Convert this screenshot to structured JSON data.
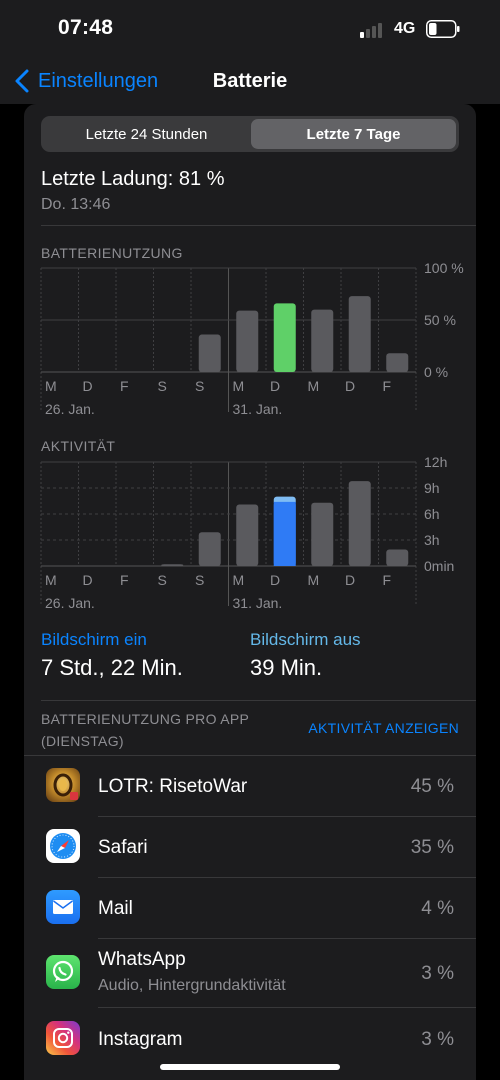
{
  "status": {
    "time": "07:48",
    "network": "4G",
    "battery_fraction": 0.3
  },
  "nav": {
    "back_label": "Einstellungen",
    "title": "Batterie"
  },
  "segments": [
    {
      "label": "Letzte 24 Stunden",
      "active": false
    },
    {
      "label": "Letzte 7 Tage",
      "active": true
    }
  ],
  "last_charge": {
    "label": "Letzte Ladung: 81 %",
    "time": "Do. 13:46"
  },
  "usage_title": "BATTERIENUTZUNG",
  "activity_title": "AKTIVITÄT",
  "screen": {
    "on_label": "Bildschirm ein",
    "on_value": "7 Std., 22 Min.",
    "off_label": "Bildschirm aus",
    "off_value": "39 Min."
  },
  "apps_header": "BATTERIENUTZUNG PRO APP (DIENSTAG)",
  "apps_link": "AKTIVITÄT ANZEIGEN",
  "colors": {
    "accent": "#0a84ff",
    "usage_highlight": "#5fd068",
    "activity_highlight": "#2f7bf5",
    "activity_highlight_top": "#7fbcf3",
    "bar": "#5a5a5e",
    "screen_off": "#64b8e9"
  },
  "chart_data": [
    {
      "type": "bar",
      "title": "BATTERIENUTZUNG",
      "categories": [
        "M",
        "D",
        "F",
        "S",
        "S",
        "M",
        "D",
        "M",
        "D",
        "F"
      ],
      "date_labels": [
        "26. Jan.",
        "",
        "",
        "",
        "",
        "31. Jan.",
        "",
        "",
        "",
        ""
      ],
      "values": [
        0,
        0,
        0,
        0,
        36,
        59,
        66,
        60,
        73,
        18
      ],
      "highlight_index": 6,
      "y_ticks": [
        "100 %",
        "50 %",
        "0 %"
      ],
      "ylim": [
        0,
        100
      ]
    },
    {
      "type": "bar",
      "title": "AKTIVITÄT",
      "categories": [
        "M",
        "D",
        "F",
        "S",
        "S",
        "M",
        "D",
        "M",
        "D",
        "F"
      ],
      "date_labels": [
        "26. Jan.",
        "",
        "",
        "",
        "",
        "31. Jan.",
        "",
        "",
        "",
        ""
      ],
      "series": [
        {
          "values": [
            0,
            0,
            0,
            0.2,
            3.9,
            7.1,
            7.4,
            7.3,
            9.8,
            1.9
          ]
        },
        {
          "values": [
            0,
            0,
            0,
            0,
            0,
            0,
            0.6,
            0,
            0,
            0
          ]
        }
      ],
      "highlight_index": 6,
      "y_ticks": [
        "12h",
        "9h",
        "6h",
        "3h",
        "0min"
      ],
      "ylim": [
        0,
        12
      ]
    }
  ],
  "apps": [
    {
      "name": "LOTR: RisetoWar",
      "sub": "",
      "percent": "45 %",
      "icon": "lotr-app-icon"
    },
    {
      "name": "Safari",
      "sub": "",
      "percent": "35 %",
      "icon": "safari-app-icon"
    },
    {
      "name": "Mail",
      "sub": "",
      "percent": "4 %",
      "icon": "mail-app-icon"
    },
    {
      "name": "WhatsApp",
      "sub": "Audio, Hintergrundaktivität",
      "percent": "3 %",
      "icon": "whatsapp-app-icon"
    },
    {
      "name": "Instagram",
      "sub": "",
      "percent": "3 %",
      "icon": "instagram-app-icon"
    }
  ]
}
